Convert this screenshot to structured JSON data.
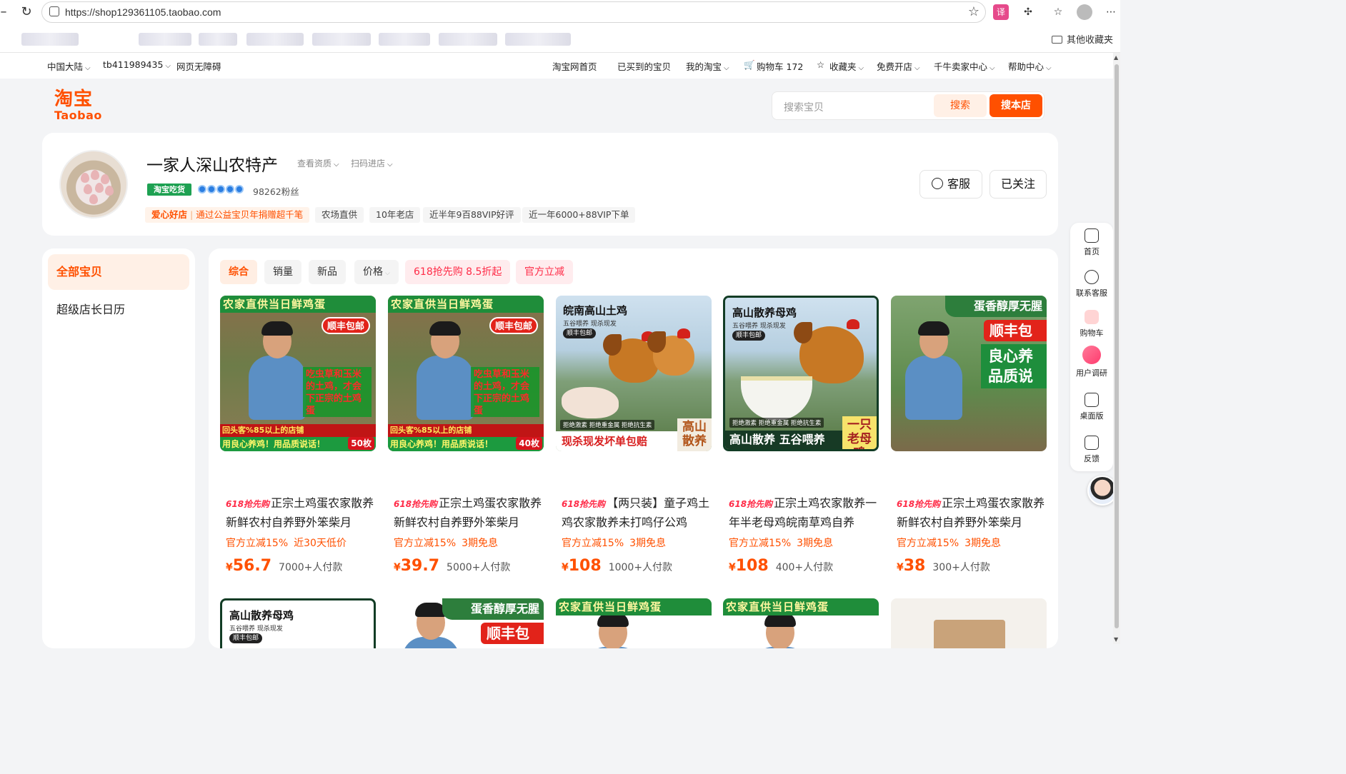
{
  "browser": {
    "url": "https://shop129361105.taobao.com",
    "bookmarks_folder": "其他收藏夹"
  },
  "site_nav": {
    "region": "中国大陆",
    "user": "tb411989435",
    "accessibility": "网页无障碍",
    "home": "淘宝网首页",
    "bought": "已买到的宝贝",
    "my_taobao": "我的淘宝",
    "cart": "购物车 172",
    "favorites": "收藏夹",
    "open_shop": "免费开店",
    "seller_center": "千牛卖家中心",
    "help": "帮助中心"
  },
  "header": {
    "logo_cn": "淘宝",
    "logo_en": "Taobao",
    "search_placeholder": "搜索宝贝",
    "search_button": "搜索",
    "search_shop_button": "搜本店"
  },
  "shop": {
    "name": "一家人深山农特产",
    "view_qualification": "查看资质",
    "scan_to_shop": "扫码进店",
    "badge": "淘宝吃货",
    "fans": "98262粉丝",
    "tags": [
      "爱心好店",
      "通过公益宝贝年捐赠超千笔",
      "农场直供",
      "10年老店",
      "近半年9百88VIP好评",
      "近一年6000+88VIP下单"
    ],
    "service_button": "客服",
    "follow_button": "已关注"
  },
  "sidebar": {
    "active": "全部宝贝",
    "items": [
      "超级店长日历"
    ]
  },
  "filters": {
    "tabs": [
      "综合",
      "销量",
      "新品",
      "价格"
    ],
    "promo_tabs": [
      "618抢先购 8.5折起",
      "官方立减"
    ]
  },
  "products": [
    {
      "tag": "618抢先购",
      "name": "正宗土鸡蛋农家散养新鲜农村自养野外笨柴月",
      "discounts": [
        "官方立减15%",
        "近30天低价"
      ],
      "price": "56.7",
      "sold": "7000+人付款",
      "img": {
        "banner": "农家直供当日鲜鸡蛋",
        "badge": "顺丰包邮",
        "red_text": "吃虫草和玉米的土鸡，才会下正宗的土鸡蛋",
        "mid": "回头客%85以上的店铺",
        "bottom": "用良心养鸡！用品质说话！",
        "count": "50枚"
      }
    },
    {
      "tag": "618抢先购",
      "name": "正宗土鸡蛋农家散养新鲜农村自养野外笨柴月",
      "discounts": [
        "官方立减15%",
        "3期免息"
      ],
      "price": "39.7",
      "sold": "5000+人付款",
      "img": {
        "banner": "农家直供当日鲜鸡蛋",
        "badge": "顺丰包邮",
        "red_text": "吃虫草和玉米的土鸡，才会下正宗的土鸡蛋",
        "mid": "回头客%85以上的店铺",
        "bottom": "用良心养鸡！用品质说话！",
        "count": "40枚"
      }
    },
    {
      "tag": "618抢先购",
      "name": "【两只装】童子鸡土鸡农家散养未打鸣仔公鸡",
      "discounts": [
        "官方立减15%",
        "3期免息"
      ],
      "price": "108",
      "sold": "1000+人付款",
      "img": {
        "title": "皖南高山土鸡",
        "sub": "五谷喂养 现杀现发",
        "pill": "顺丰包邮",
        "features": "拒绝激素 拒绝重金属 拒绝抗生素",
        "bottom": "现杀现发坏单包赔",
        "corner": "高山散养"
      }
    },
    {
      "tag": "618抢先购",
      "name": "正宗土鸡农家散养一年半老母鸡皖南草鸡自养",
      "discounts": [
        "官方立减15%",
        "3期免息"
      ],
      "price": "108",
      "sold": "400+人付款",
      "img": {
        "title": "高山散养母鸡",
        "sub": "五谷喂养 现杀现发",
        "pill": "顺丰包邮",
        "features": "拒绝激素 拒绝重金属 拒绝抗生素",
        "bottom": "高山散养 五谷喂养",
        "corner": "一只老母鸡"
      }
    },
    {
      "tag": "618抢先购",
      "name": "正宗土鸡蛋农家散养新鲜农村自养野外笨柴月",
      "discounts": [
        "官方立减15%",
        "3期免息"
      ],
      "price": "38",
      "sold": "300+人付款",
      "img": {
        "top": "蛋香醇厚无腥",
        "red": "顺丰包",
        "green": "良心养品质说"
      }
    }
  ],
  "row2": [
    {
      "title": "高山散养母鸡",
      "sub": "五谷喂养 现杀现发",
      "pill": "顺丰包邮"
    },
    {
      "top": "蛋香醇厚无腥",
      "red": "顺丰包"
    },
    {
      "banner": "农家直供当日鲜鸡蛋"
    },
    {
      "banner": "农家直供当日鲜鸡蛋"
    },
    {}
  ],
  "floatbar": {
    "items": [
      "首页",
      "联系客服",
      "购物车",
      "用户调研",
      "桌面版",
      "反馈"
    ]
  },
  "colors": {
    "accent": "#ff5000",
    "promo": "#ff2c48"
  }
}
